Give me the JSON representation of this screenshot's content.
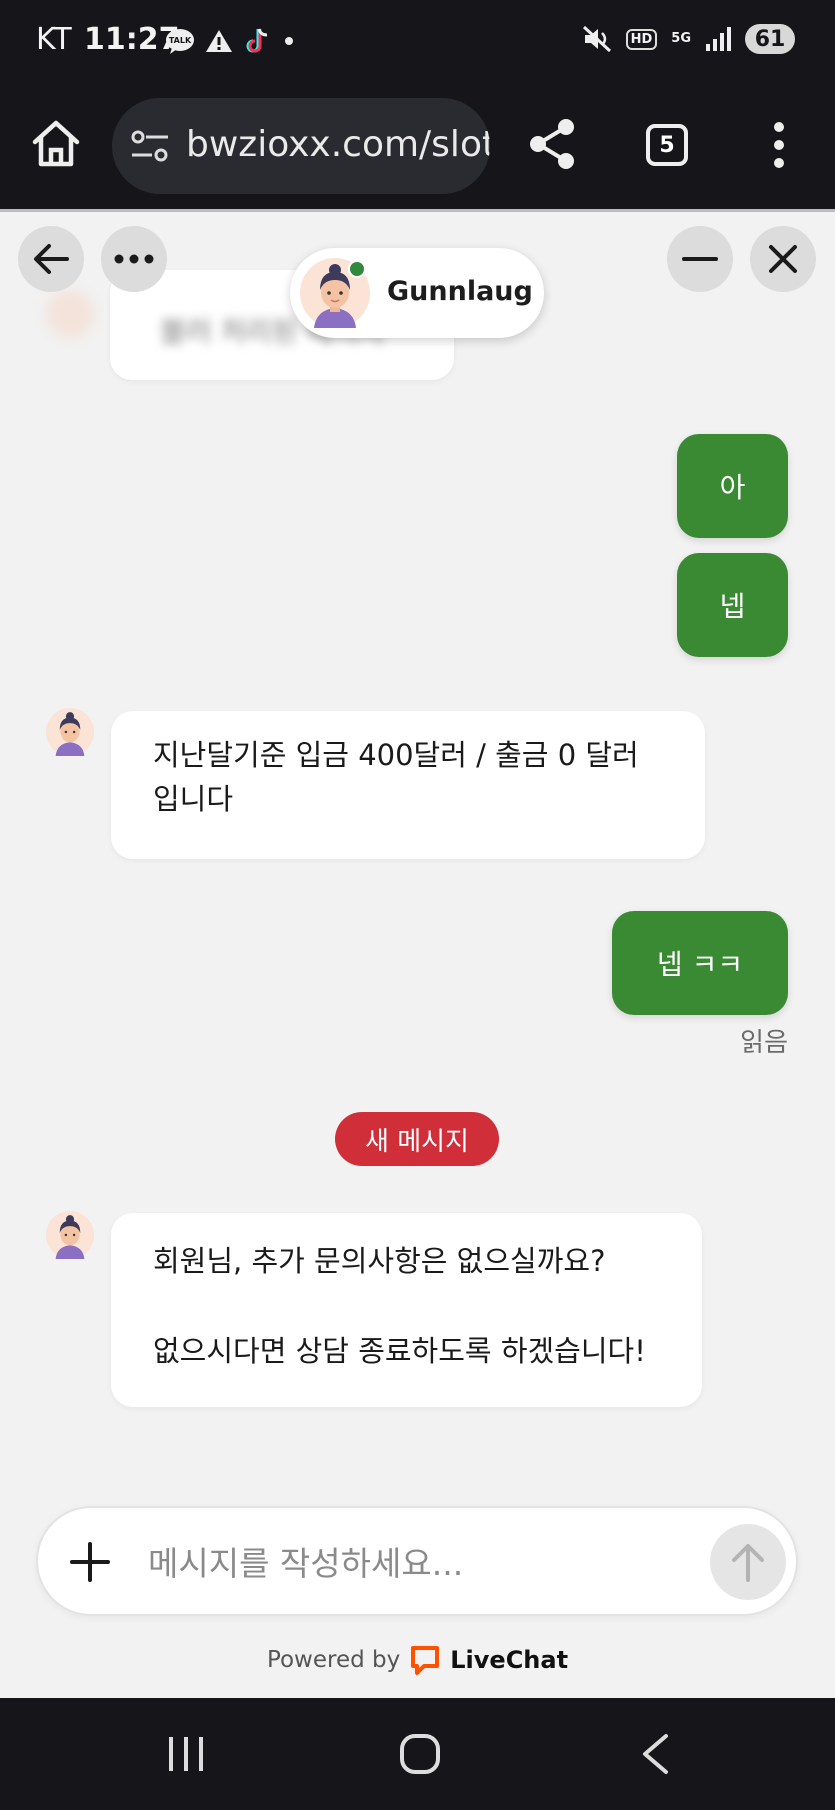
{
  "status_bar": {
    "carrier": "KT",
    "time": "11:27",
    "talk_label": "TALK",
    "hd_label": "HD",
    "network": "5G",
    "battery": "61"
  },
  "browser": {
    "url": "bwzioxx.com/slots",
    "tab_count": "5"
  },
  "chat_header": {
    "agent_name": "Gunnlaug",
    "agent_online_color": "#2f8a3e"
  },
  "messages": {
    "blurred_text": "블러 처리된 메시지",
    "user_1": "아",
    "user_2": "넵",
    "agent_1_line1": "지난달기준 입금 400달러 / 출금 0 달러",
    "agent_1_line2": "입니다",
    "user_3": "넵 ㅋㅋ",
    "read_status": "읽음",
    "new_message_divider": "새 메시지",
    "agent_2_line1": "회원님, 추가 문의사항은 없으실까요?",
    "agent_2_line2": "없으시다면 상담 종료하도록 하겠습니다!"
  },
  "composer": {
    "placeholder": "메시지를 작성하세요..."
  },
  "footer": {
    "powered_by": "Powered by",
    "brand": "LiveChat"
  },
  "colors": {
    "user_bubble": "#3a8a34",
    "new_message_badge": "#d02f3a",
    "livechat_orange": "#ff5100"
  }
}
